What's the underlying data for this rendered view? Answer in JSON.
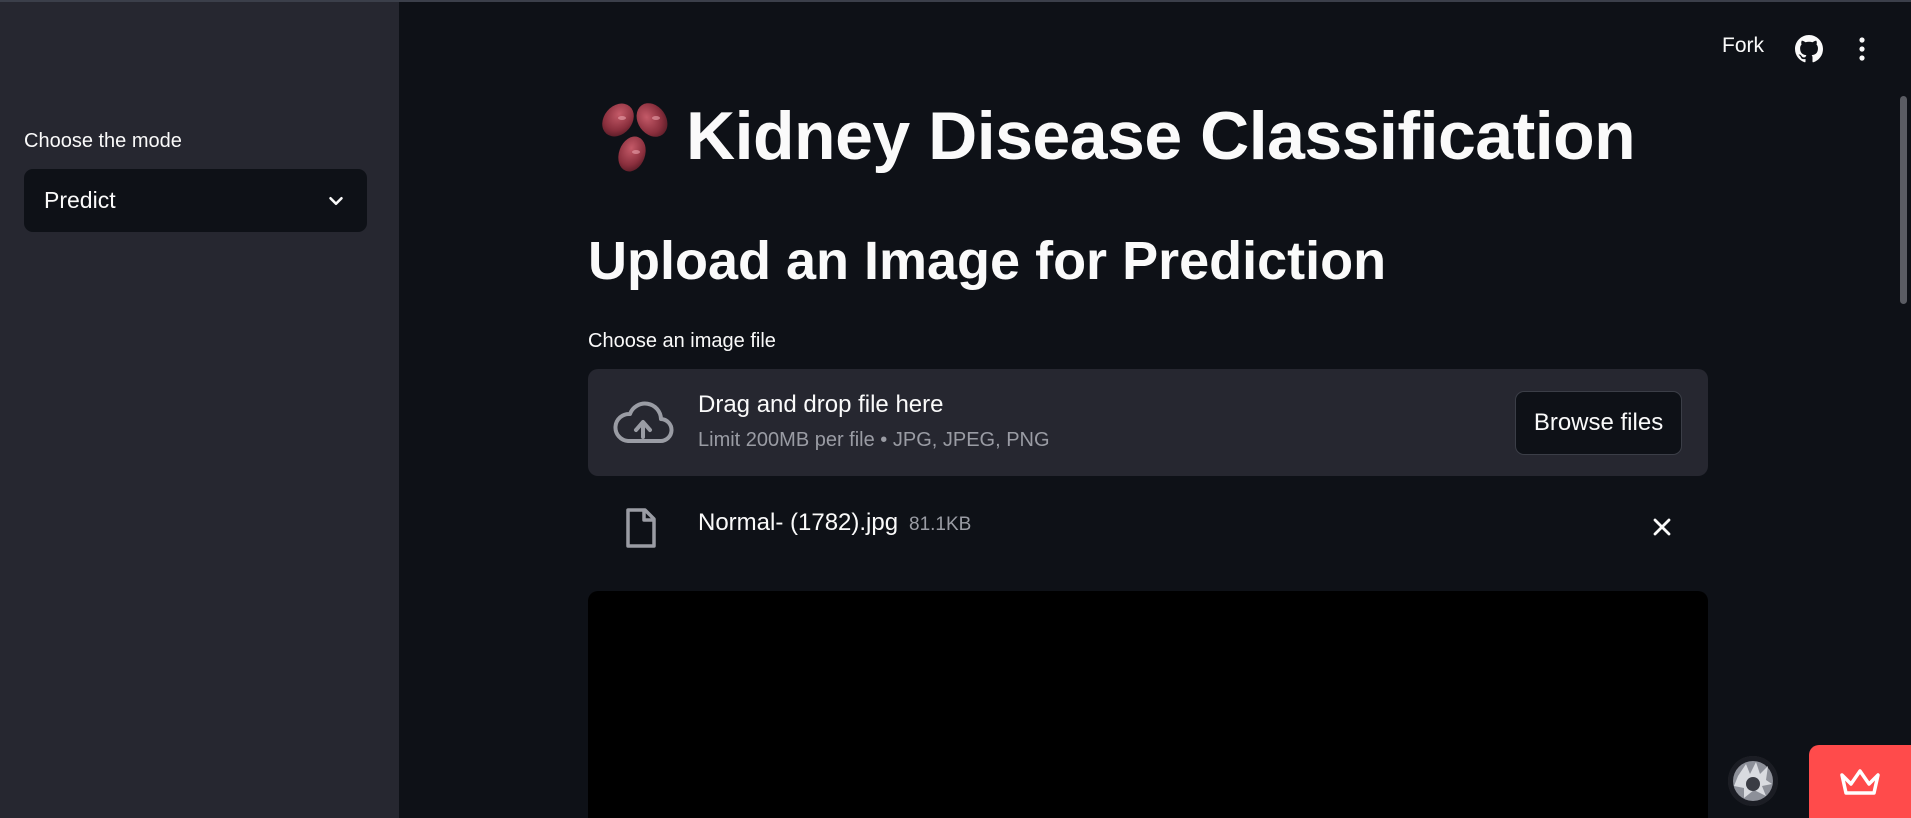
{
  "sidebar": {
    "mode_label": "Choose the mode",
    "mode_select": {
      "value": "Predict"
    }
  },
  "header": {
    "fork_label": "Fork",
    "github_icon": "github-icon",
    "menu_icon": "vertical-ellipsis-icon"
  },
  "main": {
    "title": "Kidney Disease Classification",
    "title_icon": "kidney-icon",
    "subtitle": "Upload an Image for Prediction",
    "uploader": {
      "label": "Choose an image file",
      "drop_title": "Drag and drop file here",
      "drop_subtitle": "Limit 200MB per file • JPG, JPEG, PNG",
      "browse_label": "Browse files",
      "icon": "cloud-upload-icon"
    },
    "uploaded_file": {
      "name": "Normal- (1782).jpg",
      "size": "81.1KB",
      "icon": "file-icon"
    }
  },
  "colors": {
    "background": "#0e1117",
    "sidebar": "#262730",
    "accent": "#ff4b4b",
    "muted_text": "#9a9ca4"
  }
}
